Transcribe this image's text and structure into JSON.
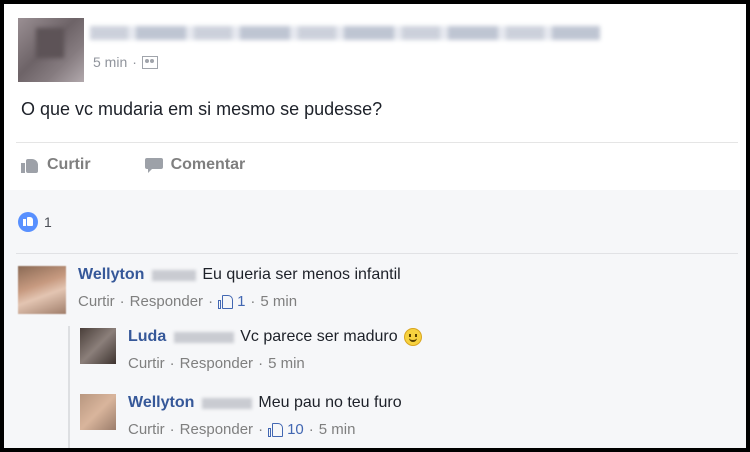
{
  "post": {
    "time": "5 min",
    "separator": "·",
    "text": "O que vc mudaria em si mesmo se pudesse?",
    "actions": {
      "like": "Curtir",
      "comment": "Comentar"
    },
    "reaction_count": "1"
  },
  "comments": [
    {
      "name": "Wellyton",
      "text": "Eu queria ser menos infantil",
      "like": "Curtir",
      "reply": "Responder",
      "likes": "1",
      "time": "5 min"
    },
    {
      "name": "Luda",
      "text": "Vc parece ser maduro",
      "like": "Curtir",
      "reply": "Responder",
      "time": "5 min"
    },
    {
      "name": "Wellyton",
      "text": "Meu pau no teu furo",
      "like": "Curtir",
      "reply": "Responder",
      "likes": "10",
      "time": "5 min"
    }
  ],
  "colors": {
    "name": "#365899",
    "like_blue": "#4267b2",
    "reaction_blue": "#5890ff",
    "meta_gray": "#90949c"
  }
}
